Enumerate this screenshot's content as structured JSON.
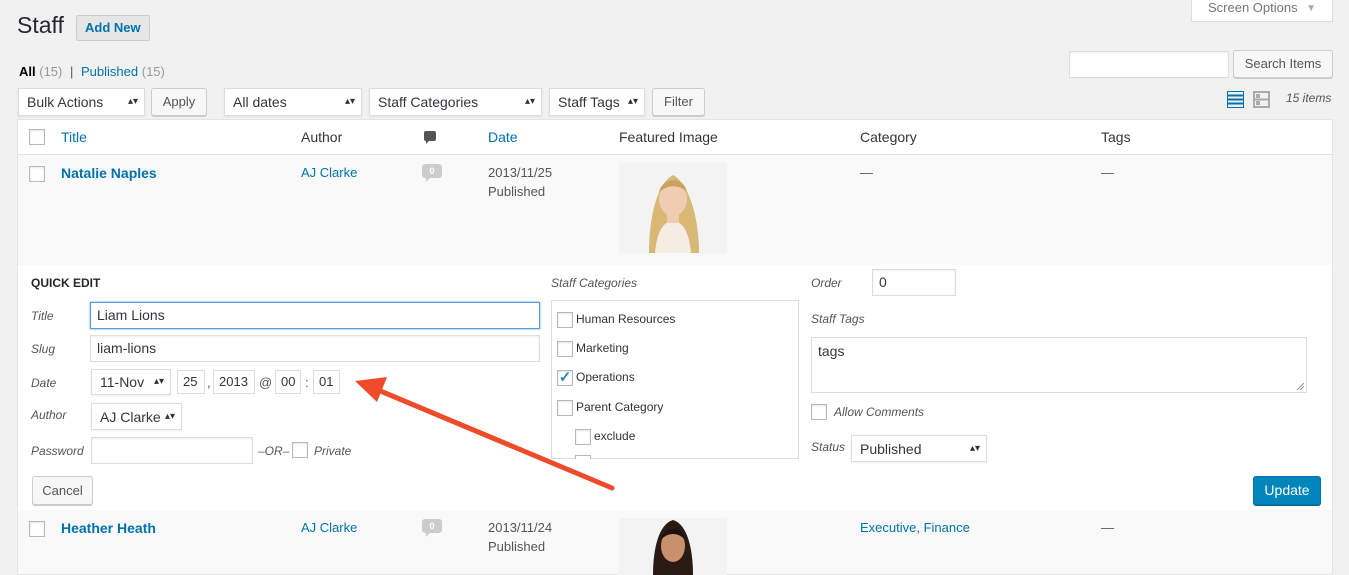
{
  "header": {
    "title": "Staff",
    "add_new": "Add New",
    "screen_options": "Screen Options"
  },
  "views": {
    "all_label": "All",
    "all_count": "(15)",
    "separator": "|",
    "published_label": "Published",
    "published_count": "(15)"
  },
  "search": {
    "value": "",
    "button": "Search Items"
  },
  "filters": {
    "bulk_actions": "Bulk Actions",
    "apply": "Apply",
    "dates": "All dates",
    "categories": "Staff Categories",
    "tags": "Staff Tags",
    "filter": "Filter",
    "items_count": "15 items"
  },
  "columns": {
    "title": "Title",
    "author": "Author",
    "date": "Date",
    "featured_image": "Featured Image",
    "category": "Category",
    "tags": "Tags"
  },
  "rows": [
    {
      "title": "Natalie Naples",
      "author": "AJ Clarke",
      "comments": "0",
      "date": "2013/11/25",
      "status": "Published",
      "category": "—",
      "tags": "—"
    },
    {
      "title": "Heather Heath",
      "author": "AJ Clarke",
      "comments": "0",
      "date": "2013/11/24",
      "status": "Published",
      "category": "Executive, Finance",
      "tags": "—"
    }
  ],
  "quick_edit": {
    "heading": "QUICK EDIT",
    "title_label": "Title",
    "title_value": "Liam Lions",
    "slug_label": "Slug",
    "slug_value": "liam-lions",
    "date_label": "Date",
    "month": "11-Nov",
    "day": "25",
    "comma": ",",
    "year": "2013",
    "at": "@",
    "hour": "00",
    "colon": ":",
    "minute": "01",
    "author_label": "Author",
    "author_value": "AJ Clarke",
    "password_label": "Password",
    "password_value": "",
    "or_label": "–OR–",
    "private_label": "Private",
    "categories_label": "Staff Categories",
    "categories": [
      {
        "label": "Human Resources",
        "checked": false
      },
      {
        "label": "Marketing",
        "checked": false
      },
      {
        "label": "Operations",
        "checked": true
      },
      {
        "label": "Parent Category",
        "checked": false
      },
      {
        "label": "exclude",
        "checked": false
      }
    ],
    "order_label": "Order",
    "order_value": "0",
    "tags_label": "Staff Tags",
    "tags_value": "tags",
    "allow_comments_label": "Allow Comments",
    "status_label": "Status",
    "status_value": "Published",
    "cancel": "Cancel",
    "update": "Update"
  },
  "colors": {
    "link": "#0073aa",
    "primary_button": "#0085ba",
    "annotation_arrow": "#ee4b2b",
    "checkmark": "#1e8cbe"
  }
}
